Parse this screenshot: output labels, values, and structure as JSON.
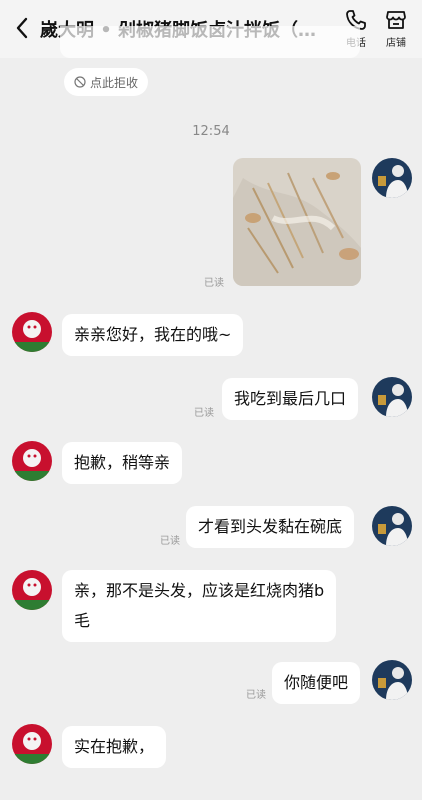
{
  "header": {
    "title": "嵗大明 • 剁椒猪脚饭卤汁拌饭（北...",
    "phone_label": "电话",
    "store_label": "店铺"
  },
  "notice": {
    "retract_label": "点此拒收"
  },
  "timestamp": "12:54",
  "messages": [
    {
      "side": "out",
      "type": "image",
      "read": "已读"
    },
    {
      "side": "in",
      "text": "亲亲您好，我在的哦~"
    },
    {
      "side": "out",
      "text": "我吃到最后几口",
      "read": "已读"
    },
    {
      "side": "in",
      "text": "抱歉，稍等亲"
    },
    {
      "side": "out",
      "text": "才看到头发黏在碗底",
      "read": "已读"
    },
    {
      "side": "in",
      "text": "亲，那不是头发，应该是红烧肉猪b",
      "text2": "毛"
    },
    {
      "side": "out",
      "text": "你随便吧",
      "read": "已读"
    },
    {
      "side": "in",
      "text": "实在抱歉，"
    }
  ],
  "colors": {
    "bg": "#eeeeee",
    "bubble": "#ffffff",
    "shop_avatar": "#c8102e",
    "user_avatar": "#1e3a5c"
  }
}
